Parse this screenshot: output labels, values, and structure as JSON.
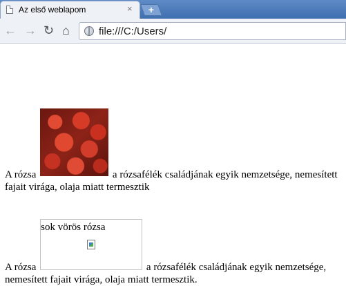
{
  "tab": {
    "title": "Az első weblapom",
    "close_glyph": "×",
    "new_tab_glyph": "+"
  },
  "toolbar": {
    "back_glyph": "←",
    "forward_glyph": "→",
    "reload_glyph": "↻",
    "home_glyph": "⌂",
    "url": "file:///C:/Users/"
  },
  "content": {
    "p1_before": "A rózsa",
    "p1_after": " a rózsafélék családjának egyik nemzetsége, nemesített fajait virága, olaja miatt termesztik",
    "image_alt": "sok vörös rózsa",
    "p2_before": "A rózsa",
    "p2_after": " a rózsafélék családjának egyik nemzetsége, nemesített fajait virága, olaja miatt termesztik."
  },
  "icons": [
    "page-icon",
    "close-icon",
    "new-tab-icon",
    "back-icon",
    "forward-icon",
    "reload-icon",
    "home-icon",
    "globe-icon",
    "rose-image",
    "broken-image-icon"
  ]
}
